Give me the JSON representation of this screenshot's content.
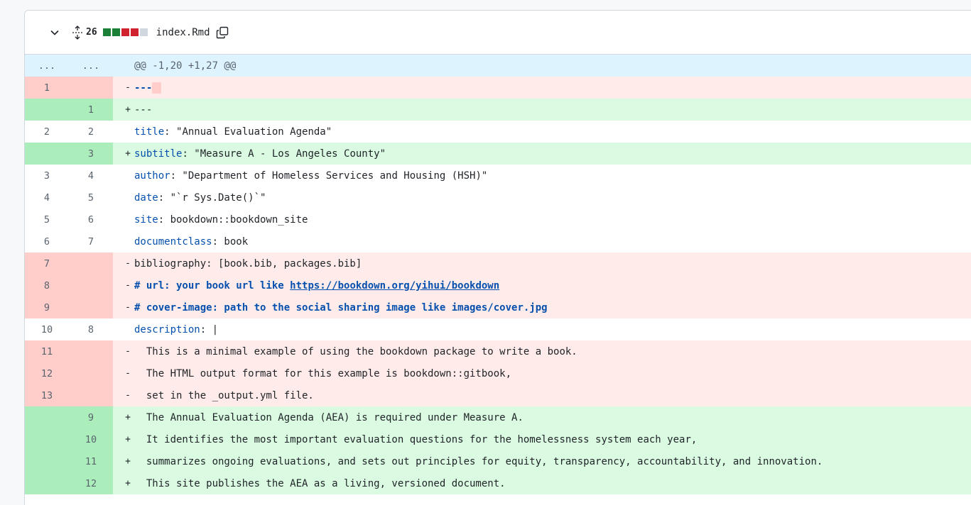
{
  "file": {
    "changes": "26",
    "name": "index.Rmd",
    "stat_colors": [
      "#1a7f37",
      "#1a7f37",
      "#cf222e",
      "#cf222e",
      "#d0d7de"
    ],
    "chevron_icon": "chevron-down-icon",
    "expand_icon": "expand-icon",
    "copy_icon": "copy-icon"
  },
  "hunk": {
    "left": "...",
    "right": "...",
    "text": "@@ -1,20 +1,27 @@"
  },
  "lines": [
    {
      "type": "del",
      "l": "1",
      "r": "",
      "sign": "-",
      "code": "---"
    },
    {
      "type": "add",
      "l": "",
      "r": "1",
      "sign": "+",
      "code": "---"
    },
    {
      "type": "ctx",
      "l": "2",
      "r": "2",
      "sign": "",
      "key": "title",
      "code": ": \"Annual Evaluation Agenda\""
    },
    {
      "type": "add",
      "l": "",
      "r": "3",
      "sign": "+",
      "key": "subtitle",
      "code": ": \"Measure A - Los Angeles County\""
    },
    {
      "type": "ctx",
      "l": "3",
      "r": "4",
      "sign": "",
      "key": "author",
      "code": ": \"Department of Homeless Services and Housing (HSH)\""
    },
    {
      "type": "ctx",
      "l": "4",
      "r": "5",
      "sign": "",
      "key": "date",
      "code": ": \"`r Sys.Date()`\""
    },
    {
      "type": "ctx",
      "l": "5",
      "r": "6",
      "sign": "",
      "key": "site",
      "code": ": bookdown::bookdown_site"
    },
    {
      "type": "ctx",
      "l": "6",
      "r": "7",
      "sign": "",
      "key": "documentclass",
      "code": ": book"
    },
    {
      "type": "del",
      "l": "7",
      "r": "",
      "sign": "-",
      "key": "",
      "code": "bibliography: [book.bib, packages.bib]"
    },
    {
      "type": "del",
      "l": "8",
      "r": "",
      "sign": "-",
      "bold": "# url: your book url like ",
      "url": "https://bookdown.org/yihui/bookdown"
    },
    {
      "type": "del",
      "l": "9",
      "r": "",
      "sign": "-",
      "bold": "# cover-image: path to the social sharing image like images/cover.jpg"
    },
    {
      "type": "ctx",
      "l": "10",
      "r": "8",
      "sign": "",
      "key": "description",
      "code": ": |"
    },
    {
      "type": "del",
      "l": "11",
      "r": "",
      "sign": "-",
      "code": "  This is a minimal example of using the bookdown package to write a book."
    },
    {
      "type": "del",
      "l": "12",
      "r": "",
      "sign": "-",
      "code": "  The HTML output format for this example is bookdown::gitbook,"
    },
    {
      "type": "del",
      "l": "13",
      "r": "",
      "sign": "-",
      "code": "  set in the _output.yml file."
    },
    {
      "type": "add",
      "l": "",
      "r": "9",
      "sign": "+",
      "code": "  The Annual Evaluation Agenda (AEA) is required under Measure A."
    },
    {
      "type": "add",
      "l": "",
      "r": "10",
      "sign": "+",
      "code": "  It identifies the most important evaluation questions for the homelessness system each year,"
    },
    {
      "type": "add",
      "l": "",
      "r": "11",
      "sign": "+",
      "code": "  summarizes ongoing evaluations, and sets out principles for equity, transparency, accountability, and innovation."
    },
    {
      "type": "add",
      "l": "",
      "r": "12",
      "sign": "+",
      "code": "  This site publishes the AEA as a living, versioned document."
    }
  ]
}
